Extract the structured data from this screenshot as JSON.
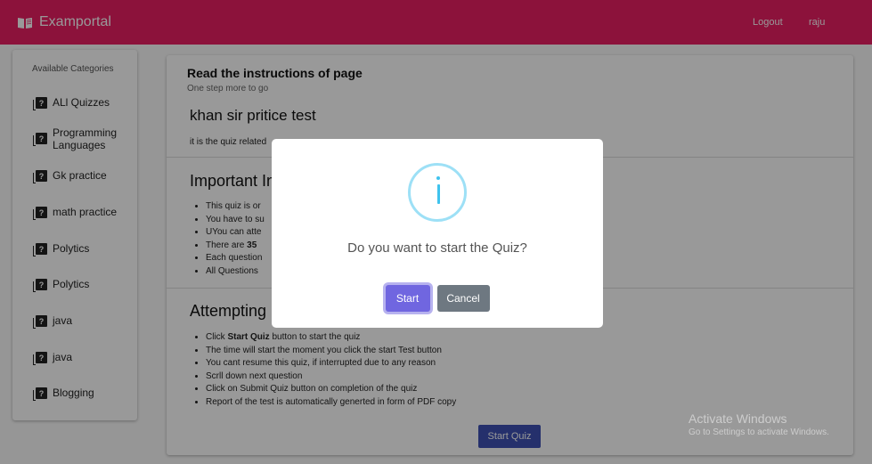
{
  "app": {
    "title": "Examportal"
  },
  "nav": {
    "logout": "Logout",
    "user": "raju"
  },
  "sidebar": {
    "title": "Available Categories",
    "items": [
      {
        "label": "ALl Quizzes"
      },
      {
        "label": "Programming Languages"
      },
      {
        "label": "Gk practice"
      },
      {
        "label": "math practice"
      },
      {
        "label": "Polytics"
      },
      {
        "label": "Polytics"
      },
      {
        "label": "java"
      },
      {
        "label": "java"
      },
      {
        "label": "Blogging"
      }
    ]
  },
  "main": {
    "title": "Read the instructions of page",
    "subtitle": "One step more to go",
    "quiz_title": "khan sir pritice test",
    "quiz_desc_visible": "it is the quiz related",
    "important_heading_visible": "Important In",
    "important_items_visible": [
      "This quiz is or",
      "You have to su",
      "UYou can atte",
      "There are",
      "Each question",
      "All Questions"
    ],
    "important_bold_count": "35",
    "attempting_heading": "Attempting",
    "attempting_items": [
      {
        "pre": "Click ",
        "bold": "Start Quiz",
        "post": " button to start the quiz"
      },
      {
        "pre": "The time will start the moment you click the start Test button",
        "bold": "",
        "post": ""
      },
      {
        "pre": "You cant resume this quiz, if interrupted due to any reason",
        "bold": "",
        "post": ""
      },
      {
        "pre": "Scrll down next question",
        "bold": "",
        "post": ""
      },
      {
        "pre": "Click on Submit Quiz button on completion of the quiz",
        "bold": "",
        "post": ""
      },
      {
        "pre": "Report of the test is automatically generted in form of PDF copy",
        "bold": "",
        "post": ""
      }
    ],
    "start_quiz_button": "Start Quiz"
  },
  "modal": {
    "icon": "info-icon",
    "question": "Do you want to start the Quiz?",
    "confirm": "Start",
    "cancel": "Cancel"
  },
  "watermark": {
    "line1": "Activate Windows",
    "line2": "Go to Settings to activate Windows."
  },
  "colors": {
    "topbar": "#e91e63",
    "primary_button": "#3f51b5",
    "modal_confirm": "#7066e0",
    "modal_cancel": "#6e7881",
    "info_icon": "#3fc3ee"
  }
}
